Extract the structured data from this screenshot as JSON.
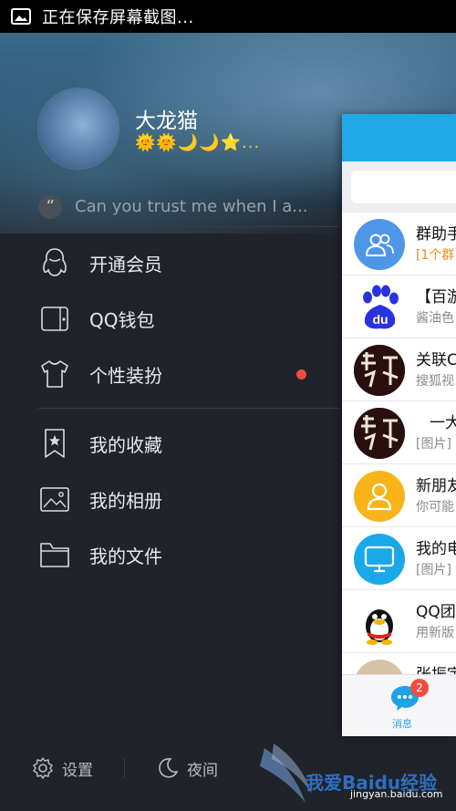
{
  "status_bar": {
    "text": "正在保存屏幕截图..."
  },
  "profile": {
    "name": "大龙猫",
    "levels": "🌞🌞🌙🌙⭐...",
    "signature": "Can you trust me when I a..."
  },
  "menu": {
    "items": [
      {
        "label": "开通会员",
        "icon": "penguin-icon"
      },
      {
        "label": "QQ钱包",
        "icon": "wallet-icon"
      },
      {
        "label": "个性装扮",
        "icon": "tshirt-icon"
      },
      {
        "label": "我的收藏",
        "icon": "bookmark-star-icon"
      },
      {
        "label": "我的相册",
        "icon": "photo-icon"
      },
      {
        "label": "我的文件",
        "icon": "folder-icon"
      }
    ]
  },
  "bottom_bar": {
    "settings_label": "设置",
    "night_label": "夜间"
  },
  "chats": [
    {
      "name": "群助手",
      "sub": "[1个群"
    },
    {
      "name": "【百游",
      "sub": "酱油色"
    },
    {
      "name": "关联C",
      "sub": "搜狐视"
    },
    {
      "name": "一大",
      "sub": "[图片]"
    },
    {
      "name": "新朋友",
      "sub": "你可能"
    },
    {
      "name": "我的电",
      "sub": "[图片]"
    },
    {
      "name": "QQ团",
      "sub": "用新版"
    },
    {
      "name": "张振宇",
      "sub": ""
    }
  ],
  "tabbar": {
    "badge": "2",
    "label": "消息"
  },
  "watermark": {
    "line1": "我爱Baidu经验",
    "line2": "jingyan.baidu.com"
  },
  "colors": {
    "qq_blue": "#20a8e8",
    "badge_red": "#f24c3d",
    "gold": "#f3c230"
  }
}
